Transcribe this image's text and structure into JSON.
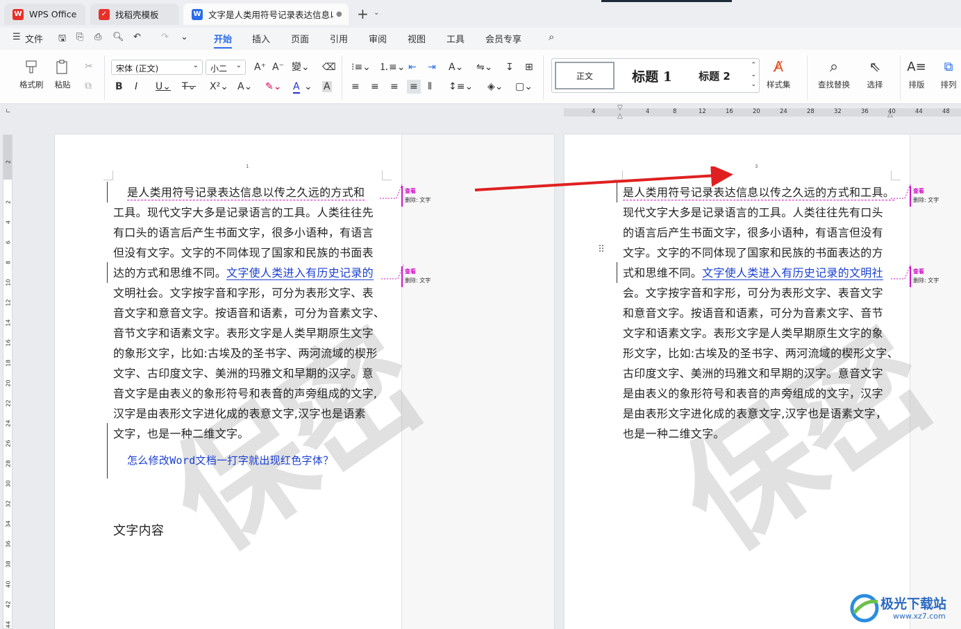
{
  "tabs": [
    {
      "label": "WPS Office"
    },
    {
      "label": "找稻壳模板"
    },
    {
      "label": "文字是人类用符号记录表达信息以"
    }
  ],
  "menu": {
    "file": "文件",
    "items": [
      "开始",
      "插入",
      "页面",
      "引用",
      "审阅",
      "视图",
      "工具",
      "会员专享"
    ],
    "active": "开始"
  },
  "ribbon": {
    "format_painter": "格式刷",
    "paste": "粘贴",
    "font_name": "宋体 (正文)",
    "font_size": "小二",
    "style_normal": "正文",
    "style_h1": "标题 1",
    "style_h2": "标题 2",
    "style_set": "样式集",
    "find_replace": "查找替换",
    "select": "选择",
    "layout": "排版",
    "arrange": "排列"
  },
  "ruler": {
    "h_ticks": [
      "4",
      "4",
      "8",
      "12",
      "16",
      "20",
      "24",
      "28",
      "32",
      "36",
      "40",
      "44",
      "48"
    ],
    "v_ticks": [
      "2",
      "2",
      "4",
      "6",
      "8",
      "10",
      "12",
      "14",
      "16",
      "18",
      "20",
      "22",
      "24",
      "26",
      "28",
      "30",
      "32",
      "34",
      "36",
      "38",
      "40",
      "42",
      "44"
    ]
  },
  "left_page": {
    "page_num": "1",
    "lines": [
      "是人类用符号记录表达信息以传之久远的方式和",
      "工具。现代文字大多是记录语言的工具。人类往往先",
      "有口头的语言后产生书面文字，很多小语种，有语言",
      "但没有文字。文字的不同体现了国家和民族的书面表",
      "达的方式和思维不同。",
      "文明社会。文字按字音和字形，可分为表形文字、表",
      "音文字和意音文字。按语音和语素，可分为音素文字、",
      "音节文字和语素文字。表形文字是人类早期原生文字",
      "的象形文字，比如:古埃及的圣书字、两河流域的楔形",
      "文字、古印度文字、美洲的玛雅文和早期的汉字。意",
      "音文字是由表义的象形符号和表音的声旁组成的文字,",
      "汉字是由表形文字进化成的表意文字,汉字也是语素",
      "文字，也是一种二维文字。"
    ],
    "inserted_phrase": "文字使人类进入有历史记录的",
    "link_line": "怎么修改Word文档一打字就出现红色字体？",
    "heading": "文字内容",
    "watermark": "保密"
  },
  "right_page": {
    "page_num": "3",
    "lines": [
      "是人类用符号记录表达信息以传之久远的方式和工具。",
      "现代文字大多是记录语言的工具。人类往往先有口头",
      "的语言后产生书面文字，很多小语种，有语言但没有",
      "文字。文字的不同体现了国家和民族的书面表达的方",
      "式和思维不同。",
      "会。文字按字音和字形，可分为表形文字、表音文字",
      "和意音文字。按语音和语素，可分为音素文字、音节",
      "文字和语素文字。表形文字是人类早期原生文字的象",
      "形文字，比如:古埃及的圣书字、两河流域的楔形文字、",
      "古印度文字、美洲的玛雅文和早期的汉字。意音文字",
      "是由表义的象形符号和表音的声旁组成的文字，汉字",
      "是由表形文字进化成的表意文字,汉字也是语素文字，",
      "也是一种二维文字。"
    ],
    "inserted_phrase": "文字使人类进入有历史记录的文明社",
    "watermark": "保密"
  },
  "balloons": {
    "tag": "查看",
    "text": "删除: 文字"
  },
  "watermark_brand": {
    "name": "极光下载站",
    "url": "www.xz7.com"
  },
  "colors": {
    "accent": "#2b6de8",
    "revision": "#d010c8",
    "arrow": "#e02020",
    "inserted": "#1a3fd0"
  }
}
